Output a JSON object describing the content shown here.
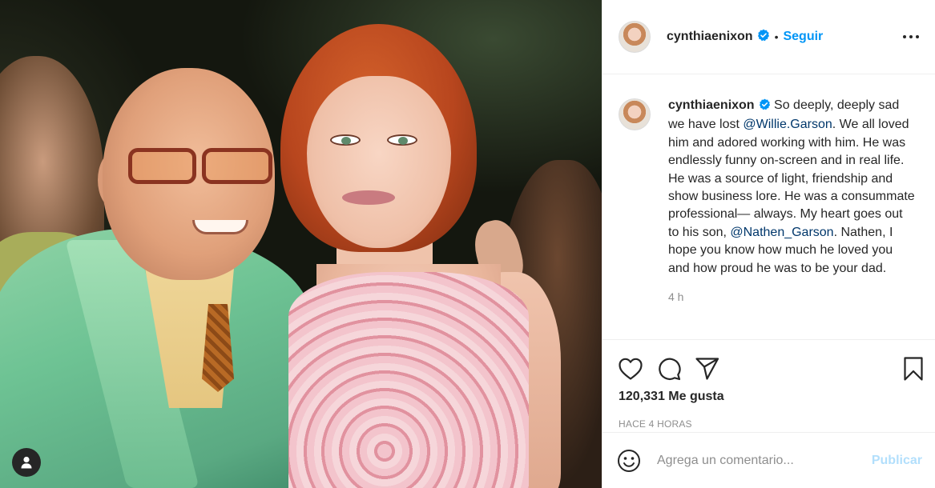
{
  "post": {
    "username": "cynthiaenixon",
    "verified": true,
    "follow_separator": "•",
    "follow_label": "Seguir",
    "more_icon": "more-horizontal-icon"
  },
  "caption": {
    "username": "cynthiaenixon",
    "text_1": " So deeply, deeply sad we have lost ",
    "mention_1": "@Willie.Garson",
    "text_2": ". We all loved him and adored working with him. He was endlessly funny on-screen and in real life. He was a source of light, friendship and show business lore. He was a consummate professional— always. My heart goes out to his son, ",
    "mention_2": "@Nathen_Garson",
    "text_3": ". Nathen, I hope you know how much he loved you and how proud he was to be your dad.",
    "time": "4 h"
  },
  "actions": {
    "icons": [
      "heart-icon",
      "comment-icon",
      "share-icon",
      "bookmark-icon"
    ],
    "likes": "120,331 Me gusta",
    "posted": "HACE 4 HORAS"
  },
  "comment_box": {
    "emoji_icon": "emoji-icon",
    "placeholder": "Agrega un comentario...",
    "publish_label": "Publicar"
  },
  "colors": {
    "link": "#0095f6",
    "mention": "#00376b",
    "muted": "#8e8e8e",
    "publish_disabled": "#b2dffc"
  }
}
